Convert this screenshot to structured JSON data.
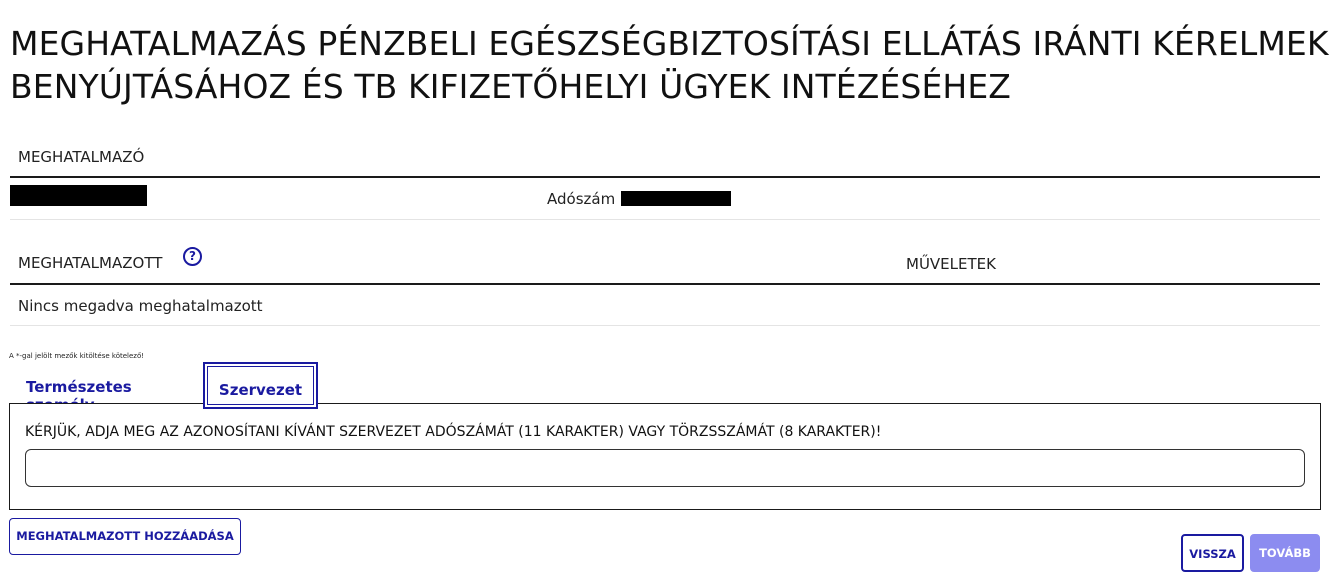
{
  "page": {
    "title_line1": "MEGHATALMAZÁS PÉNZBELI EGÉSZSÉGBIZTOSÍTÁSI ELLÁTÁS IRÁNTI KÉRELMEK",
    "title_line2": "BENYÚJTÁSÁHOZ ÉS TB KIFIZETŐHELYI ÜGYEK INTÉZÉSÉHEZ"
  },
  "meghatalmazo": {
    "header": "MEGHATALMAZÓ",
    "tax_label": "Adószám"
  },
  "meghatalmazott": {
    "header": "MEGHATALMAZOTT",
    "help_symbol": "?",
    "actions_header": "MŰVELETEK",
    "empty_text": "Nincs megadva meghatalmazott"
  },
  "form": {
    "required_note": "A *-gal jelölt mezők kitöltése kötelező!",
    "tabs": [
      {
        "label": "Természetes személy",
        "active": false
      },
      {
        "label": "Szervezet",
        "active": true
      }
    ],
    "field_label": "KÉRJÜK, ADJA MEG AZ AZONOSÍTANI KÍVÁNT SZERVEZET ADÓSZÁMÁT (11 KARAKTER) VAGY TÖRZSSZÁMÁT (8 KARAKTER)!",
    "field_value": ""
  },
  "buttons": {
    "add_label": "MEGHATALMAZOTT HOZZÁADÁSA",
    "back_label": "VISSZA",
    "next_label": "TOVÁBB"
  },
  "colors": {
    "accent": "#1a1aa0",
    "disabled_primary": "#8c8cf0",
    "text": "#1a1a1a"
  }
}
